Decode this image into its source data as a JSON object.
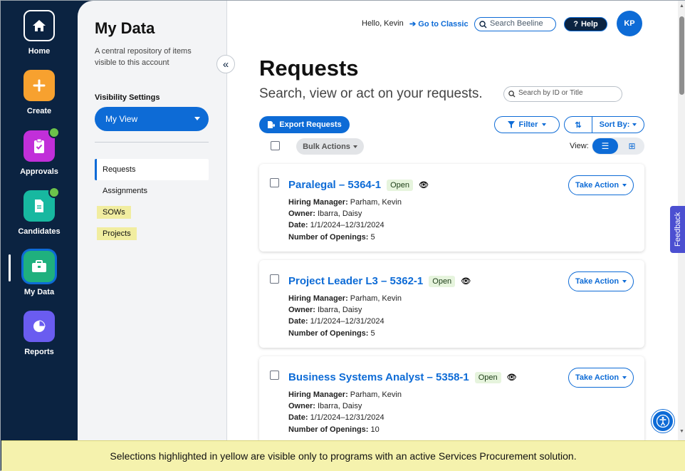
{
  "nav": {
    "items": [
      {
        "label": "Home",
        "icon": "home-icon",
        "color": "#0b2341"
      },
      {
        "label": "Create",
        "icon": "plus-icon",
        "color": "#f7a12f"
      },
      {
        "label": "Approvals",
        "icon": "clipboard-check-icon",
        "color": "#c12fd9"
      },
      {
        "label": "Candidates",
        "icon": "document-icon",
        "color": "#17b8a0"
      },
      {
        "label": "My Data",
        "icon": "briefcase-icon",
        "color": "#1fb07e"
      },
      {
        "label": "Reports",
        "icon": "pie-chart-icon",
        "color": "#6a5cf0"
      }
    ]
  },
  "panel": {
    "title": "My Data",
    "description": "A central repository of items visible to this account",
    "visibility_label": "Visibility Settings",
    "view_select": "My View",
    "items": [
      {
        "label": "Requests"
      },
      {
        "label": "Assignments"
      },
      {
        "label": "SOWs"
      },
      {
        "label": "Projects"
      }
    ]
  },
  "topbar": {
    "greeting": "Hello, Kevin",
    "classic_link": "Go to Classic",
    "search_placeholder": "Search Beeline",
    "help_label": "Help",
    "avatar_initials": "KP"
  },
  "main": {
    "title": "Requests",
    "subtitle": "Search, view or act on your requests.",
    "search_placeholder": "Search by ID or Title",
    "export_label": "Export Requests",
    "filter_label": "Filter",
    "sort_label": "Sort By:",
    "bulk_label": "Bulk Actions",
    "view_label": "View:",
    "take_action_label": "Take Action",
    "field_labels": {
      "hiring_manager": "Hiring Manager:",
      "owner": "Owner:",
      "date": "Date:",
      "openings": "Number of Openings:"
    },
    "requests": [
      {
        "title": "Paralegal – 5364-1",
        "status": "Open",
        "hiring_manager": "Parham, Kevin",
        "owner": "Ibarra, Daisy",
        "date": "1/1/2024–12/31/2024",
        "openings": "5"
      },
      {
        "title": "Project Leader L3 – 5362-1",
        "status": "Open",
        "hiring_manager": "Parham, Kevin",
        "owner": "Ibarra, Daisy",
        "date": "1/1/2024–12/31/2024",
        "openings": "5"
      },
      {
        "title": "Business Systems Analyst – 5358-1",
        "status": "Open",
        "hiring_manager": "Parham, Kevin",
        "owner": "Ibarra, Daisy",
        "date": "1/1/2024–12/31/2024",
        "openings": "10"
      }
    ]
  },
  "feedback_label": "Feedback",
  "banner_text": "Selections highlighted in yellow are visible only to programs with an active Services Procurement solution.",
  "colors": {
    "accent": "#0d6bd6",
    "navy": "#0b2341",
    "highlight": "#f1eda0",
    "open_badge": "#e6f4dd"
  }
}
